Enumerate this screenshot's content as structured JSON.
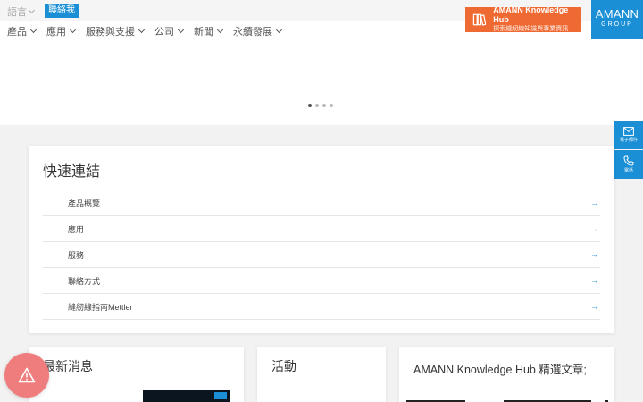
{
  "topbar": {
    "language_label": "語言",
    "action_label": "聯絡我們"
  },
  "nav": [
    {
      "label": "產品"
    },
    {
      "label": "應用"
    },
    {
      "label": "服務與支援"
    },
    {
      "label": "公司"
    },
    {
      "label": "新聞"
    },
    {
      "label": "永續發展"
    }
  ],
  "knowledge_hub": {
    "title": "AMANN Knowledge Hub",
    "subtitle": "探索縫紉線知識與專業資訊",
    "icon": "books-icon"
  },
  "logo": {
    "main": "AMANN",
    "sub": "GROUP"
  },
  "carousel": {
    "slides": 4,
    "active": 1
  },
  "side": {
    "email_label": "電子郵件",
    "phone_label": "電話"
  },
  "card": {
    "title": "快速連結",
    "items": [
      {
        "label": "產品概覽"
      },
      {
        "label": "應用"
      },
      {
        "label": "服務"
      },
      {
        "label": "聯絡方式"
      },
      {
        "label": "縫紉線指南Mettler"
      }
    ]
  },
  "bottom": {
    "card1_title": "最新消息",
    "card2_title": "活動",
    "card3_title": "AMANN Knowledge Hub 精選文章;"
  },
  "colors": {
    "brand_blue": "#1a8fd6",
    "hub_orange": "#ef6a33",
    "alert_red": "#f07d7d"
  }
}
